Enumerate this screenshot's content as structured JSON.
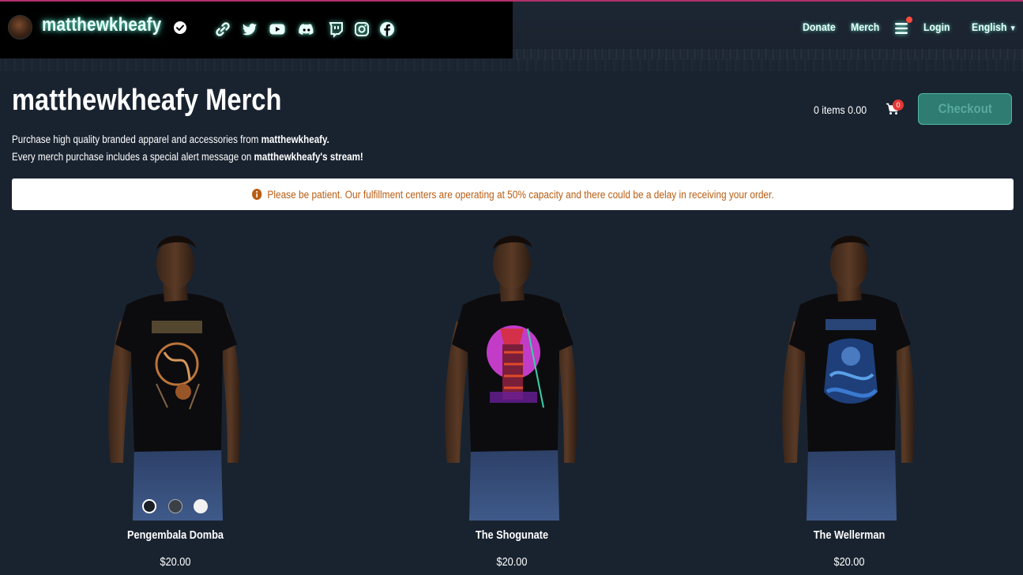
{
  "colors": {
    "background": "#192330",
    "header_left_bg": "#000000",
    "glow": "#6effdc",
    "checkout_bg": "#2f7d72",
    "checkout_text": "#5aa99d",
    "notice_text": "#b85d12",
    "cart_badge": "#e53935",
    "menu_dot": "#ff4b3e"
  },
  "header": {
    "brand": "matthewkheafy",
    "verified_icon": "verified-check-icon",
    "social_icons": [
      "link-icon",
      "twitter-icon",
      "youtube-icon",
      "discord-icon",
      "twitch-icon",
      "instagram-icon",
      "facebook-icon"
    ],
    "nav": {
      "donate": "Donate",
      "merch": "Merch",
      "menu_icon": "hamburger-menu-icon",
      "login": "Login",
      "language": "English"
    }
  },
  "page": {
    "title": "matthewkheafy Merch",
    "desc1_prefix": "Purchase high quality branded apparel and accessories from ",
    "desc1_bold": "matthewkheafy.",
    "desc2_prefix": "Every merch purchase includes a special alert message on ",
    "desc2_bold": "matthewkheafy's stream!"
  },
  "cart": {
    "summary": "0 items 0.00",
    "count": "0",
    "checkout_label": "Checkout"
  },
  "notice": {
    "icon": "info-circle-icon",
    "text": "Please be patient. Our fulfillment centers are operating at 50% capacity and there could be a delay in receiving your order."
  },
  "products": [
    {
      "name": "Pengembala Domba",
      "price": "$20.00",
      "swatches": [
        "#1b1f26",
        "#3b3f46",
        "#f2f2f2"
      ],
      "selected_swatch": 0
    },
    {
      "name": "The Shogunate",
      "price": "$20.00"
    },
    {
      "name": "The Wellerman",
      "price": "$20.00"
    }
  ]
}
